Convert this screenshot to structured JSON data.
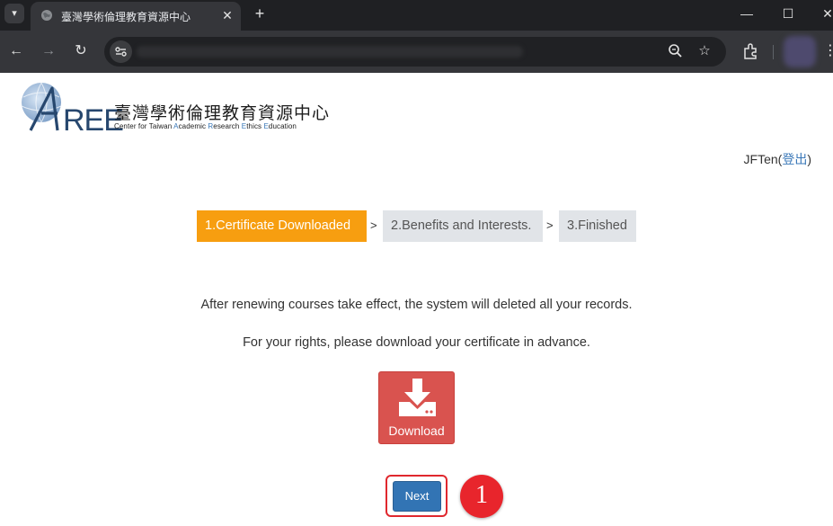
{
  "browser": {
    "tab_title": "臺灣學術倫理教育資源中心",
    "tab_list_icon": "chevron-down-icon",
    "new_tab_label": "+",
    "window_controls": {
      "minimize": "—",
      "maximize": "☐",
      "close": "✕"
    },
    "icons": [
      "back-icon",
      "forward-icon",
      "reload-icon",
      "site-info-icon",
      "zoom-icon",
      "bookmark-star-icon",
      "extensions-icon",
      "profile-avatar",
      "menu-icon"
    ]
  },
  "logo": {
    "name_zh": "臺灣學術倫理教育資源中心",
    "name_en_parts": [
      "Center for Taiwan ",
      "A",
      "cademic ",
      "R",
      "esearch ",
      "E",
      "thics ",
      "E",
      "ducation"
    ]
  },
  "user": {
    "username": "JFTen",
    "open_paren": "(",
    "logout_label": "登出",
    "close_paren": ")"
  },
  "steps": [
    {
      "label": "1.Certificate Downloaded",
      "active": true
    },
    {
      "label": "2.Benefits and Interests.",
      "active": false
    },
    {
      "label": "3.Finished",
      "active": false
    }
  ],
  "step_separator": ">",
  "messages": {
    "line1": "After renewing courses take effect, the system will deleted all your records.",
    "line2": "For your rights, please download your certificate in advance."
  },
  "download_button": {
    "label": "Download",
    "icon": "download-icon"
  },
  "next_button": {
    "label": "Next"
  },
  "annotation": {
    "number": "1",
    "color": "#e8252c"
  },
  "colors": {
    "active_step": "#f79e10",
    "inactive_step": "#e1e4e8",
    "download": "#d9534f",
    "next": "#3274b4",
    "link": "#3a78b8"
  }
}
